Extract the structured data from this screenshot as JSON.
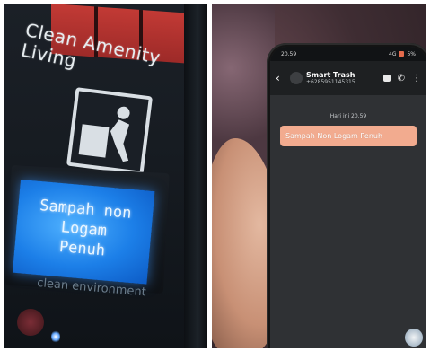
{
  "left_photo": {
    "sign_text": "Clean Amenity Living",
    "lcd_line1": "Sampah non Logam",
    "lcd_line2": "Penuh",
    "lower_sign_text": "clean environment"
  },
  "right_photo": {
    "status_bar": {
      "time": "20.59",
      "signal": "4G",
      "battery": "5%"
    },
    "chat": {
      "contact_name": "Smart Trash",
      "contact_phone": "+6285951145315",
      "day_label": "Hari ini 20.59",
      "message": "Sampah Non Logam Penuh"
    }
  },
  "colors": {
    "lcd_blue": "#1c7fe8",
    "bubble": "#f2ab8f",
    "chat_bg": "#2f3134",
    "red_strip": "#c23a35"
  },
  "icons": [
    "back-arrow-icon",
    "video-call-icon",
    "phone-icon",
    "more-vert-icon",
    "trash-person-icon"
  ]
}
